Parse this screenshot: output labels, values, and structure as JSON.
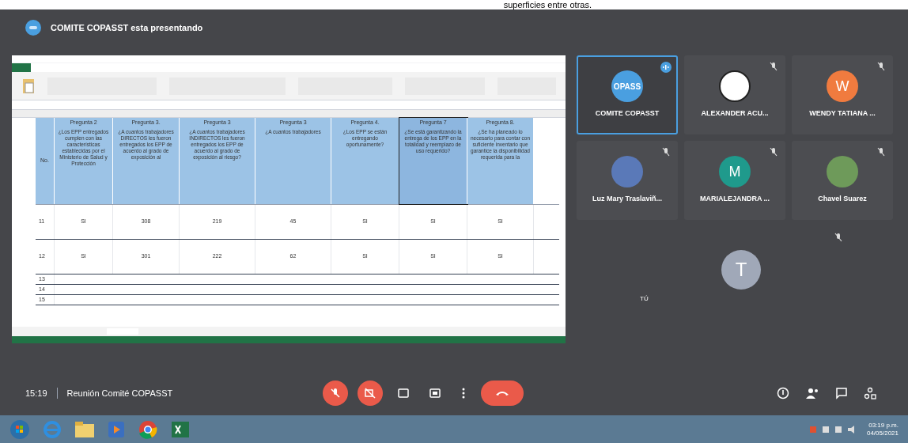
{
  "document_caption": "superficies entre otras.",
  "presenter_banner": {
    "text": "COMITE COPASST esta presentando"
  },
  "spreadsheet": {
    "first_header": "No.",
    "headers": [
      {
        "title": "Pregunta 2",
        "question": "¿Los EPP entregados cumplen con las características establecidas por el Ministerio de Salud y Protección",
        "selected": false
      },
      {
        "title": "Pregunta 3.",
        "question": "¿A cuantos trabajadores DIRECTOS les fueron entregados los EPP de acuerdo al grado de exposición al",
        "selected": false
      },
      {
        "title": "Pregunta 3",
        "question": "¿A cuantos trabajadores INDIRECTOS les fueron entregados los EPP de acuerdo al grado de exposición al riesgo?",
        "selected": false
      },
      {
        "title": "Pregunta 3",
        "question": "¿A cuantos trabajadores",
        "selected": false
      },
      {
        "title": "Pregunta 4.",
        "question": "¿Los EPP se están entregando oportunamente?",
        "selected": false
      },
      {
        "title": "Pregunta 7",
        "question": "¿Se está garantizando la entrega de los EPP en la totalidad y reemplazo de uso requerido?",
        "selected": true
      },
      {
        "title": "Pregunta 8.",
        "question": "¿Se ha planeado lo necesario para contar con suficiente inventario que garantice la disponibilidad requerida para la",
        "selected": false
      }
    ],
    "rows": [
      {
        "cells": [
          "11",
          "SI",
          "308",
          "219",
          "45",
          "SI",
          "SI",
          "SI"
        ]
      },
      {
        "cells": [
          "12",
          "SI",
          "301",
          "222",
          "62",
          "SI",
          "SI",
          "SI"
        ]
      },
      {
        "cells": [
          "13"
        ]
      },
      {
        "cells": [
          "14"
        ]
      },
      {
        "cells": [
          "15"
        ]
      }
    ]
  },
  "participants": [
    {
      "name": "COMITE COPASST",
      "avatar_text": "OPASS",
      "color": "#4a9fe0",
      "kind": "initial",
      "speaking": true,
      "muted": false
    },
    {
      "name": "ALEXANDER ACU...",
      "color": "#ffffff",
      "kind": "logo",
      "speaking": false,
      "muted": true
    },
    {
      "name": "WENDY TATIANA ...",
      "avatar_text": "W",
      "color": "#f07b3f",
      "kind": "initial",
      "speaking": false,
      "muted": true
    },
    {
      "name": "Luz Mary Traslaviñ...",
      "color": "#5a79b8",
      "kind": "photo",
      "speaking": false,
      "muted": true
    },
    {
      "name": "MARIALEJANDRA ...",
      "avatar_text": "M",
      "color": "#1f9a8c",
      "kind": "initial",
      "speaking": false,
      "muted": true
    },
    {
      "name": "Chavel Suarez",
      "color": "#6e9a5a",
      "kind": "photo",
      "speaking": false,
      "muted": true
    }
  ],
  "self_tile": {
    "name": "TÚ",
    "avatar_text": "T",
    "muted": true
  },
  "meeting_bar": {
    "time": "15:19",
    "title": "Reunión Comité COPASST"
  },
  "clock": {
    "time": "03:19 p.m.",
    "date": "04/05/2021"
  }
}
